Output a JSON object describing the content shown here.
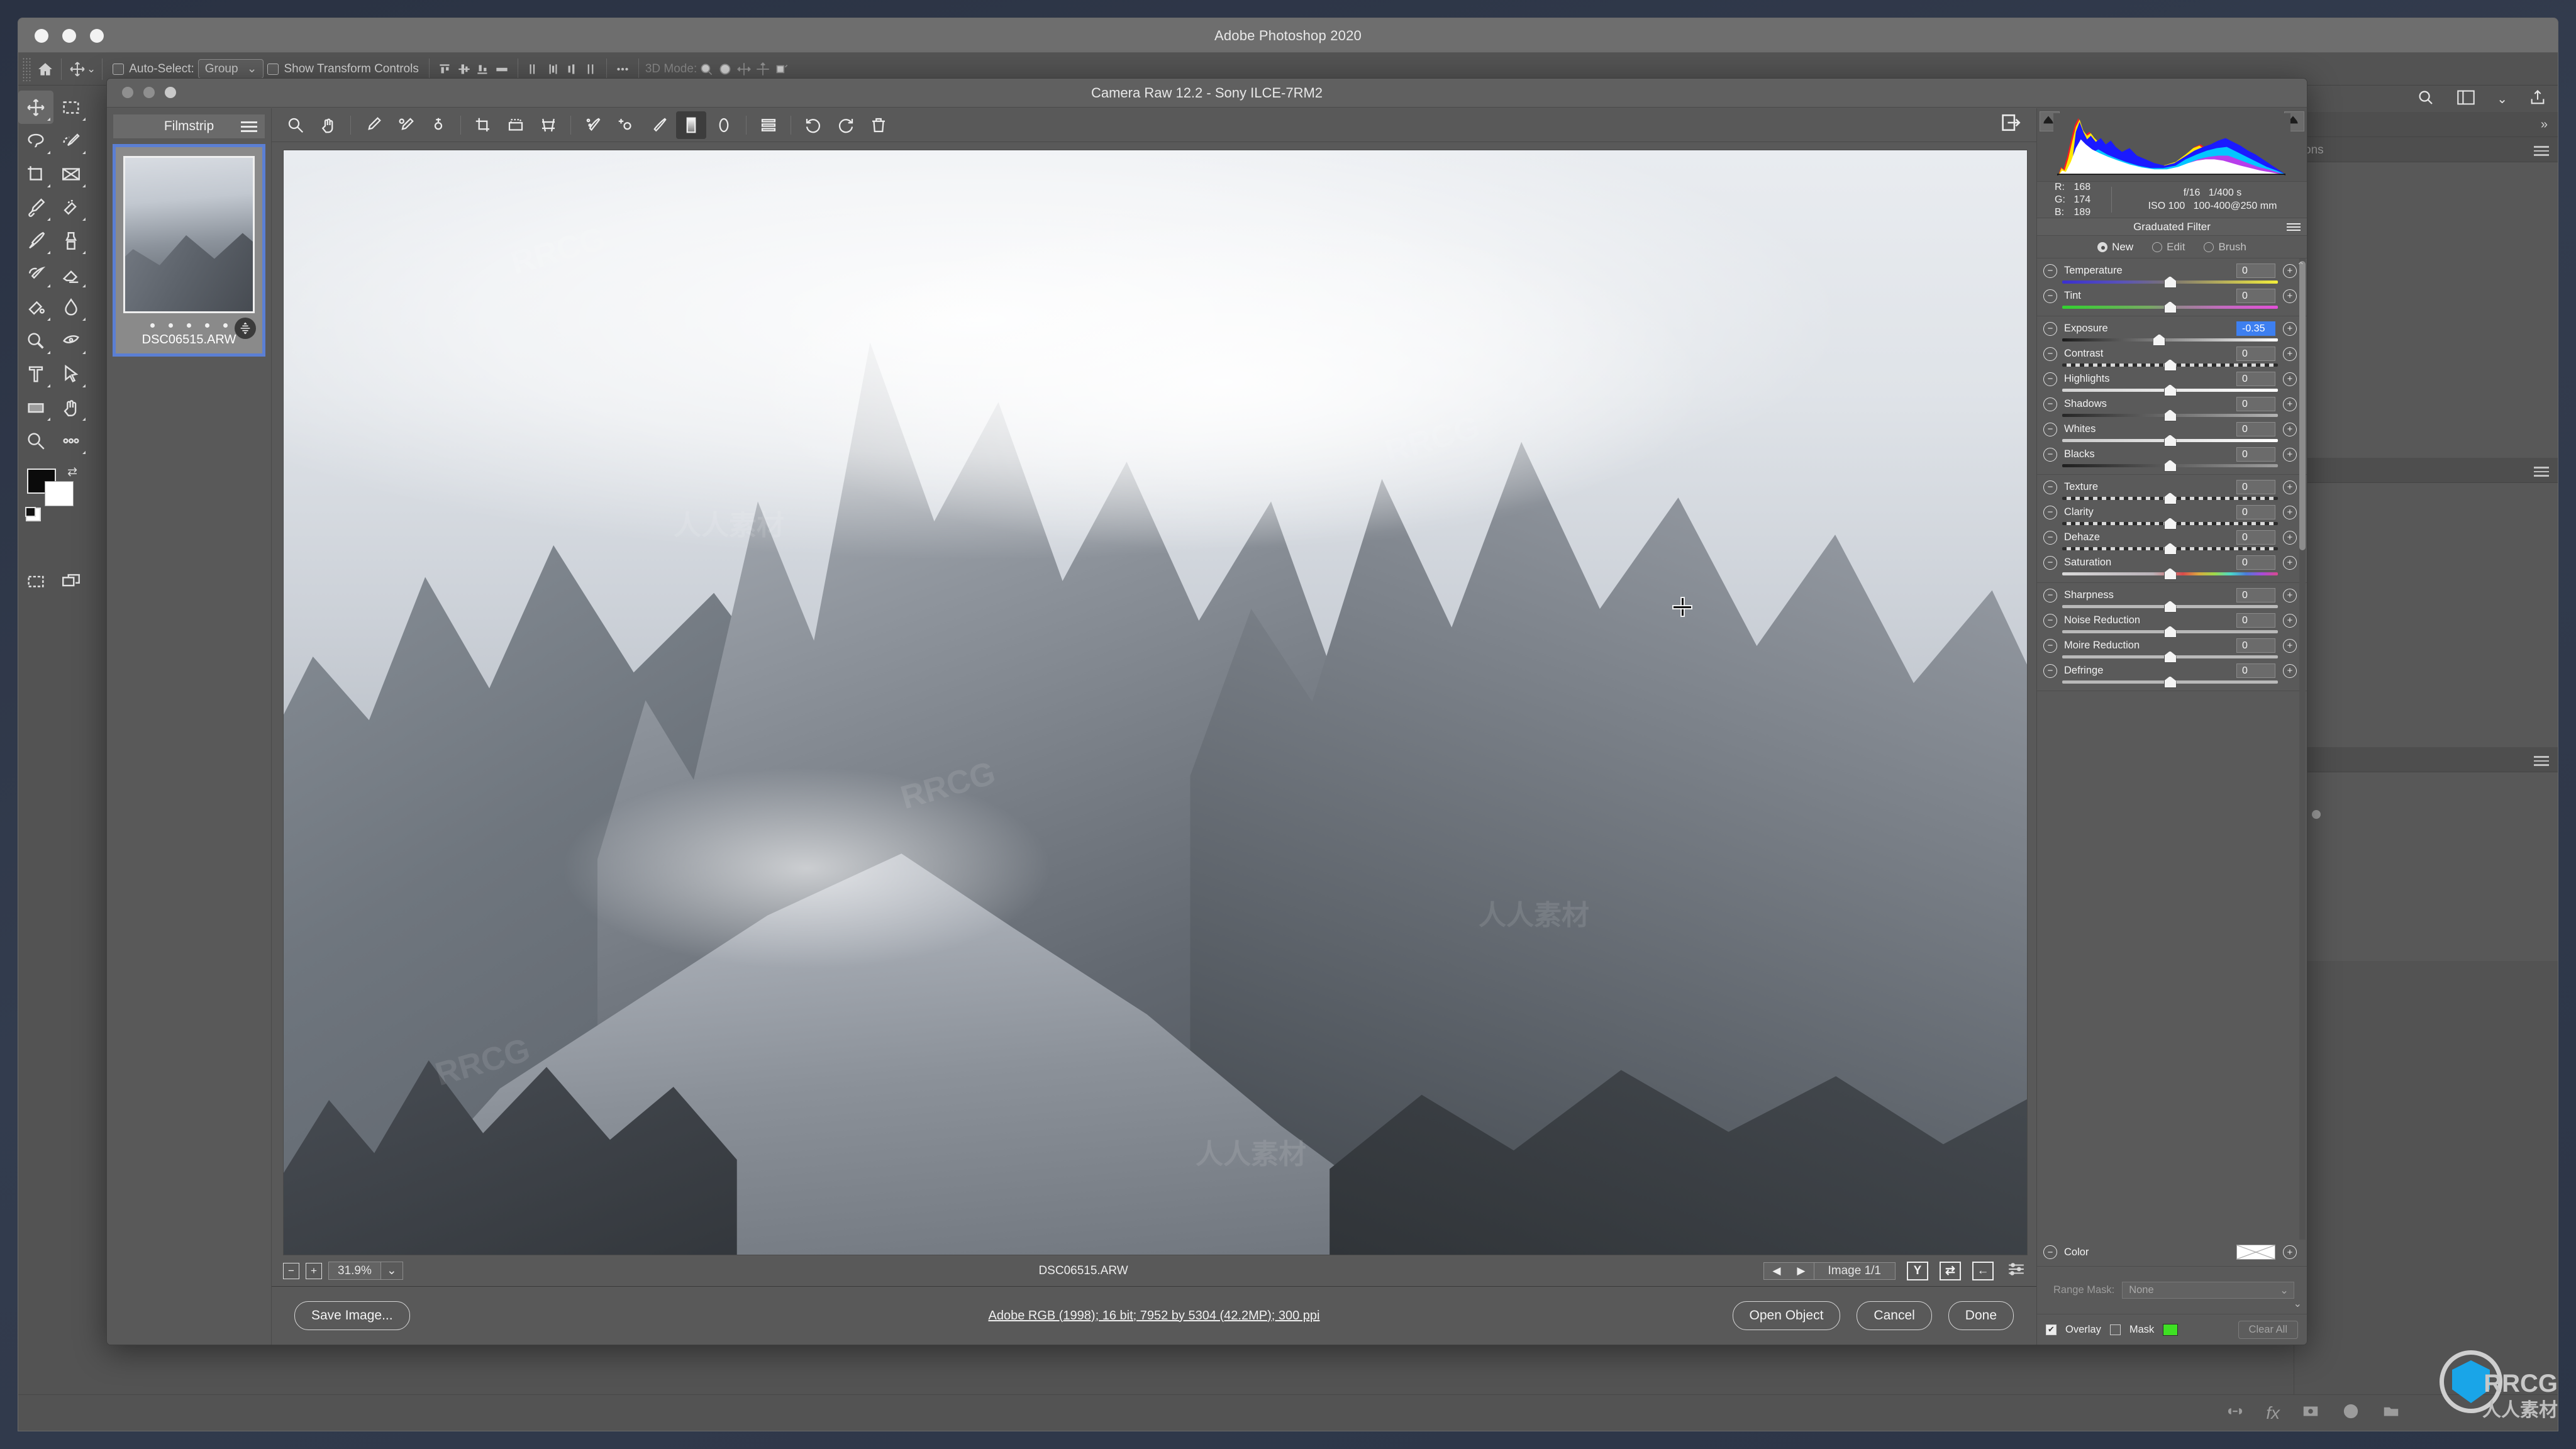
{
  "os": {
    "traffic_lights": [
      "close",
      "minimize",
      "maximize"
    ]
  },
  "photoshop": {
    "title": "Adobe Photoshop 2020",
    "options_bar": {
      "home_icon": "home-icon",
      "move_tool_icon": "move-tool-icon",
      "auto_select_label": "Auto-Select:",
      "auto_select_value": "Group",
      "show_transform_label": "Show Transform Controls",
      "three_d_mode_label": "3D Mode:",
      "align_icons": [
        "align-top-edges",
        "align-vertical-centers",
        "align-bottom-edges",
        "align-horizontal-distribute",
        "align-left-edges",
        "align-horizontal-centers",
        "align-right-edges",
        "align-vertical-distribute"
      ],
      "more_icon": "ellipsis-icon",
      "three_d_icons": [
        "rotate-3d-icon",
        "roll-3d-icon",
        "pan-3d-icon",
        "slide-3d-icon",
        "scale-3d-icon"
      ]
    },
    "toolbar_tools": [
      "move-tool",
      "rectangular-marquee-tool",
      "lasso-tool",
      "quick-selection-tool",
      "crop-tool",
      "frame-tool",
      "eyedropper-tool",
      "spot-healing-brush-tool",
      "brush-tool",
      "clone-stamp-tool",
      "history-brush-tool",
      "eraser-tool",
      "gradient-tool",
      "blur-tool",
      "dodge-tool",
      "pen-tool",
      "type-tool",
      "path-selection-tool",
      "rectangle-tool",
      "hand-tool",
      "zoom-tool",
      "edit-toolbar-tool"
    ],
    "swatches": {
      "foreground": "#0b0b0b",
      "background": "#ffffff"
    },
    "header_icons": [
      "search-icon",
      "workspace-icon",
      "chevron-down-icon",
      "share-icon"
    ],
    "right_dock": {
      "panel_label": "ons",
      "collapse_icon": "double-chevron-right-icon"
    },
    "status_icons": [
      "link-layers-icon",
      "fx-icon",
      "layer-mask-icon",
      "adjustment-layer-icon",
      "new-group-icon"
    ]
  },
  "camera_raw": {
    "title": "Camera Raw 12.2  -  Sony ILCE-7RM2",
    "toolbar_icons": [
      "zoom-tool-icon",
      "hand-tool-icon",
      "white-balance-eyedropper-icon",
      "color-sampler-icon",
      "targeted-adjustment-icon",
      "crop-tool-icon",
      "straighten-tool-icon",
      "transform-tool-icon",
      "spot-removal-icon",
      "red-eye-removal-icon",
      "adjustment-brush-icon",
      "graduated-filter-icon",
      "radial-filter-icon",
      "presets-icon",
      "rotate-counterclockwise-icon",
      "rotate-clockwise-icon",
      "delete-icon"
    ],
    "active_tool": "graduated-filter-icon",
    "panel_toggle_icon": "toggle-panel-icon",
    "filmstrip": {
      "header": "Filmstrip",
      "menu_icon": "hamburger-menu-icon",
      "items": [
        {
          "filename": "DSC06515.ARW",
          "selected": true,
          "rating_dots": 5,
          "badge_icon": "graduated-filter-badge-icon"
        }
      ]
    },
    "histogram": {
      "shadow_clipping_icon": "shadow-clipping-warning-icon",
      "highlight_clipping_icon": "highlight-clipping-warning-icon"
    },
    "readout": {
      "r_label": "R:",
      "r_value": "168",
      "g_label": "G:",
      "g_value": "174",
      "b_label": "B:",
      "b_value": "189",
      "aperture": "f/16",
      "shutter": "1/400 s",
      "iso": "ISO 100",
      "lens": "100-400@250 mm"
    },
    "panel": {
      "header": "Graduated Filter",
      "header_menu_icon": "hamburger-menu-icon",
      "modes": [
        {
          "label": "New",
          "selected": true
        },
        {
          "label": "Edit",
          "selected": false
        },
        {
          "label": "Brush",
          "selected": false
        }
      ],
      "slider_groups": [
        {
          "sliders": [
            {
              "label": "Temperature",
              "value": "0",
              "pos": 50,
              "track": "t-temp",
              "selected": false
            },
            {
              "label": "Tint",
              "value": "0",
              "pos": 50,
              "track": "t-tint",
              "selected": false
            }
          ]
        },
        {
          "sliders": [
            {
              "label": "Exposure",
              "value": "-0.35",
              "pos": 45,
              "track": "t-exp",
              "selected": true
            },
            {
              "label": "Contrast",
              "value": "0",
              "pos": 50,
              "track": "t-grad",
              "selected": false
            },
            {
              "label": "Highlights",
              "value": "0",
              "pos": 50,
              "track": "t-hl",
              "selected": false
            },
            {
              "label": "Shadows",
              "value": "0",
              "pos": 50,
              "track": "t-sh",
              "selected": false
            },
            {
              "label": "Whites",
              "value": "0",
              "pos": 50,
              "track": "t-wh",
              "selected": false
            },
            {
              "label": "Blacks",
              "value": "0",
              "pos": 50,
              "track": "t-bl",
              "selected": false
            }
          ]
        },
        {
          "sliders": [
            {
              "label": "Texture",
              "value": "0",
              "pos": 50,
              "track": "t-grad",
              "selected": false
            },
            {
              "label": "Clarity",
              "value": "0",
              "pos": 50,
              "track": "t-grad",
              "selected": false
            },
            {
              "label": "Dehaze",
              "value": "0",
              "pos": 50,
              "track": "t-grad",
              "selected": false
            },
            {
              "label": "Saturation",
              "value": "0",
              "pos": 50,
              "track": "t-sat",
              "selected": false
            }
          ]
        },
        {
          "sliders": [
            {
              "label": "Sharpness",
              "value": "0",
              "pos": 50,
              "track": "t-plain",
              "selected": false
            },
            {
              "label": "Noise Reduction",
              "value": "0",
              "pos": 50,
              "track": "t-plain",
              "selected": false
            },
            {
              "label": "Moire Reduction",
              "value": "0",
              "pos": 50,
              "track": "t-plain",
              "selected": false
            },
            {
              "label": "Defringe",
              "value": "0",
              "pos": 50,
              "track": "t-plain",
              "selected": false
            }
          ]
        }
      ],
      "color_label": "Color",
      "color_swatch": "none",
      "range_mask_label": "Range Mask:",
      "range_mask_value": "None",
      "overlay_label": "Overlay",
      "overlay_checked": true,
      "mask_label": "Mask",
      "mask_checked": false,
      "mask_color": "#3ee023",
      "clear_all_label": "Clear All"
    },
    "status_bar": {
      "zoom_out_icon": "zoom-out-icon",
      "zoom_in_icon": "zoom-in-icon",
      "zoom_value": "31.9%",
      "zoom_dropdown_icon": "chevron-down-icon",
      "filename": "DSC06515.ARW",
      "prev_icon": "previous-image-icon",
      "next_icon": "next-image-icon",
      "image_counter": "Image 1/1",
      "buttons": [
        "toggle-before-after-icon",
        "swap-before-after-icon",
        "copy-settings-icon",
        "sliders-icon"
      ]
    },
    "footer": {
      "save_image_label": "Save Image...",
      "workflow_options": "Adobe RGB (1998); 16 bit; 7952 by 5304 (42.2MP); 300 ppi",
      "open_object_label": "Open Object",
      "cancel_label": "Cancel",
      "done_label": "Done"
    }
  },
  "watermarks": {
    "latin": "RRCG",
    "cjk": "人人素材",
    "logo_text": "RRCG",
    "logo_sub": "人人素材"
  },
  "colors": {
    "accent_blue": "#3d7ff0",
    "filmstrip_selection": "#5b7fd4",
    "mask_green": "#3ee023",
    "panel_bg": "#5a5a5a",
    "app_bg": "#535353"
  }
}
